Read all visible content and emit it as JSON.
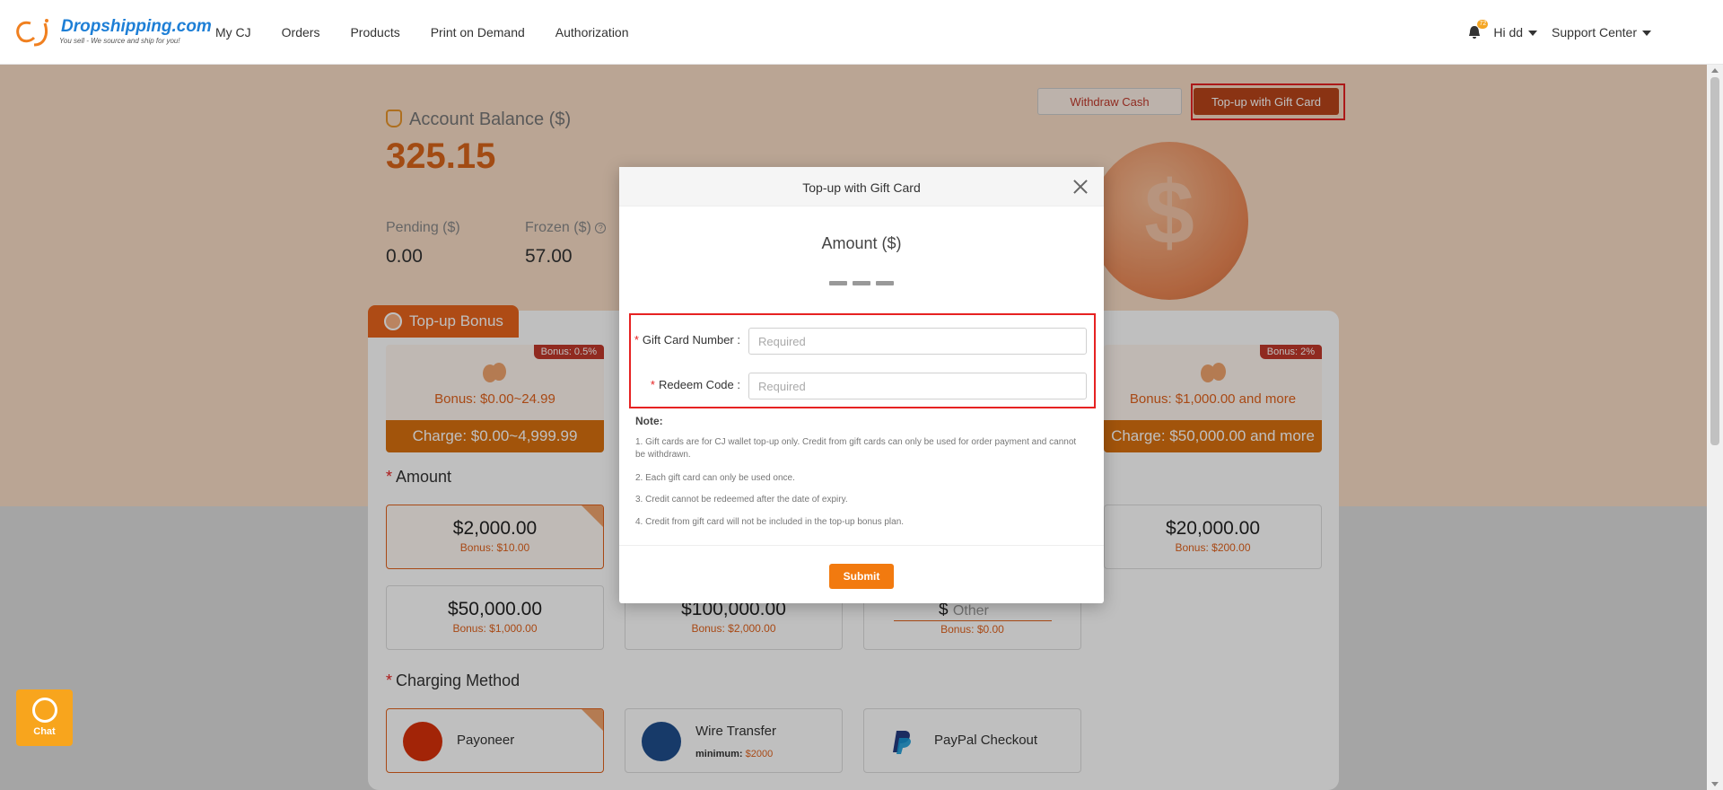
{
  "topnav": {
    "brand": "Dropshipping.com",
    "tagline": "You sell - We source and ship for you!",
    "items": [
      {
        "label": "My CJ"
      },
      {
        "label": "Orders"
      },
      {
        "label": "Products"
      },
      {
        "label": "Print on Demand"
      },
      {
        "label": "Authorization"
      }
    ],
    "notification_count": "72",
    "user_label": "Hi dd",
    "support_label": "Support Center"
  },
  "account": {
    "balance_label": "Account Balance ($)",
    "balance_value": "325.15",
    "pending_label": "Pending ($)",
    "pending_value": "0.00",
    "frozen_label": "Frozen ($)",
    "frozen_value": "57.00",
    "withdraw_label": "Withdraw Cash",
    "topup_gift_label": "Top-up with Gift Card"
  },
  "bonus": {
    "title": "Top-up Bonus",
    "tiers": [
      {
        "badge": "Bonus: 0.5%",
        "bonus": "Bonus: $0.00~24.99",
        "charge": "Charge: $0.00~4,999.99"
      },
      {
        "badge": "Bonus: 2%",
        "bonus": "Bonus: $1,000.00 and more",
        "charge": "Charge: $50,000.00 and more"
      }
    ]
  },
  "amount": {
    "title": "Amount",
    "options": [
      {
        "value": "$2,000.00",
        "bonus": "Bonus: $10.00"
      },
      {
        "value": "$20,000.00",
        "bonus": "Bonus: $200.00"
      },
      {
        "value": "$50,000.00",
        "bonus": "Bonus: $1,000.00"
      },
      {
        "value": "$100,000.00",
        "bonus": "Bonus: $2,000.00"
      },
      {
        "value": "Other",
        "bonus": "Bonus: $0.00"
      }
    ]
  },
  "charging": {
    "title": "Charging Method",
    "methods": [
      {
        "name": "Payoneer"
      },
      {
        "name": "Wire Transfer",
        "min_label": "minimum:",
        "min_value": "$2000"
      },
      {
        "name": "PayPal Checkout"
      }
    ]
  },
  "modal": {
    "title": "Top-up with Gift Card",
    "amount_label": "Amount ($)",
    "gift_card_label": "Gift Card Number",
    "gift_card_placeholder": "Required",
    "redeem_label": "Redeem Code",
    "redeem_placeholder": "Required",
    "note_title": "Note:",
    "notes": [
      "1. Gift cards are for CJ wallet top-up only. Credit from gift cards can only be used for order payment and cannot be withdrawn.",
      "2. Each gift card can only be used once.",
      "3. Credit cannot be redeemed after the date of expiry.",
      "4. Credit from gift card will not be included in the top-up bonus plan."
    ],
    "submit_label": "Submit"
  },
  "chat": {
    "label": "Chat"
  },
  "colors": {
    "accent": "#e0621d",
    "highlight": "#e62222",
    "submit": "#f27a0f"
  }
}
